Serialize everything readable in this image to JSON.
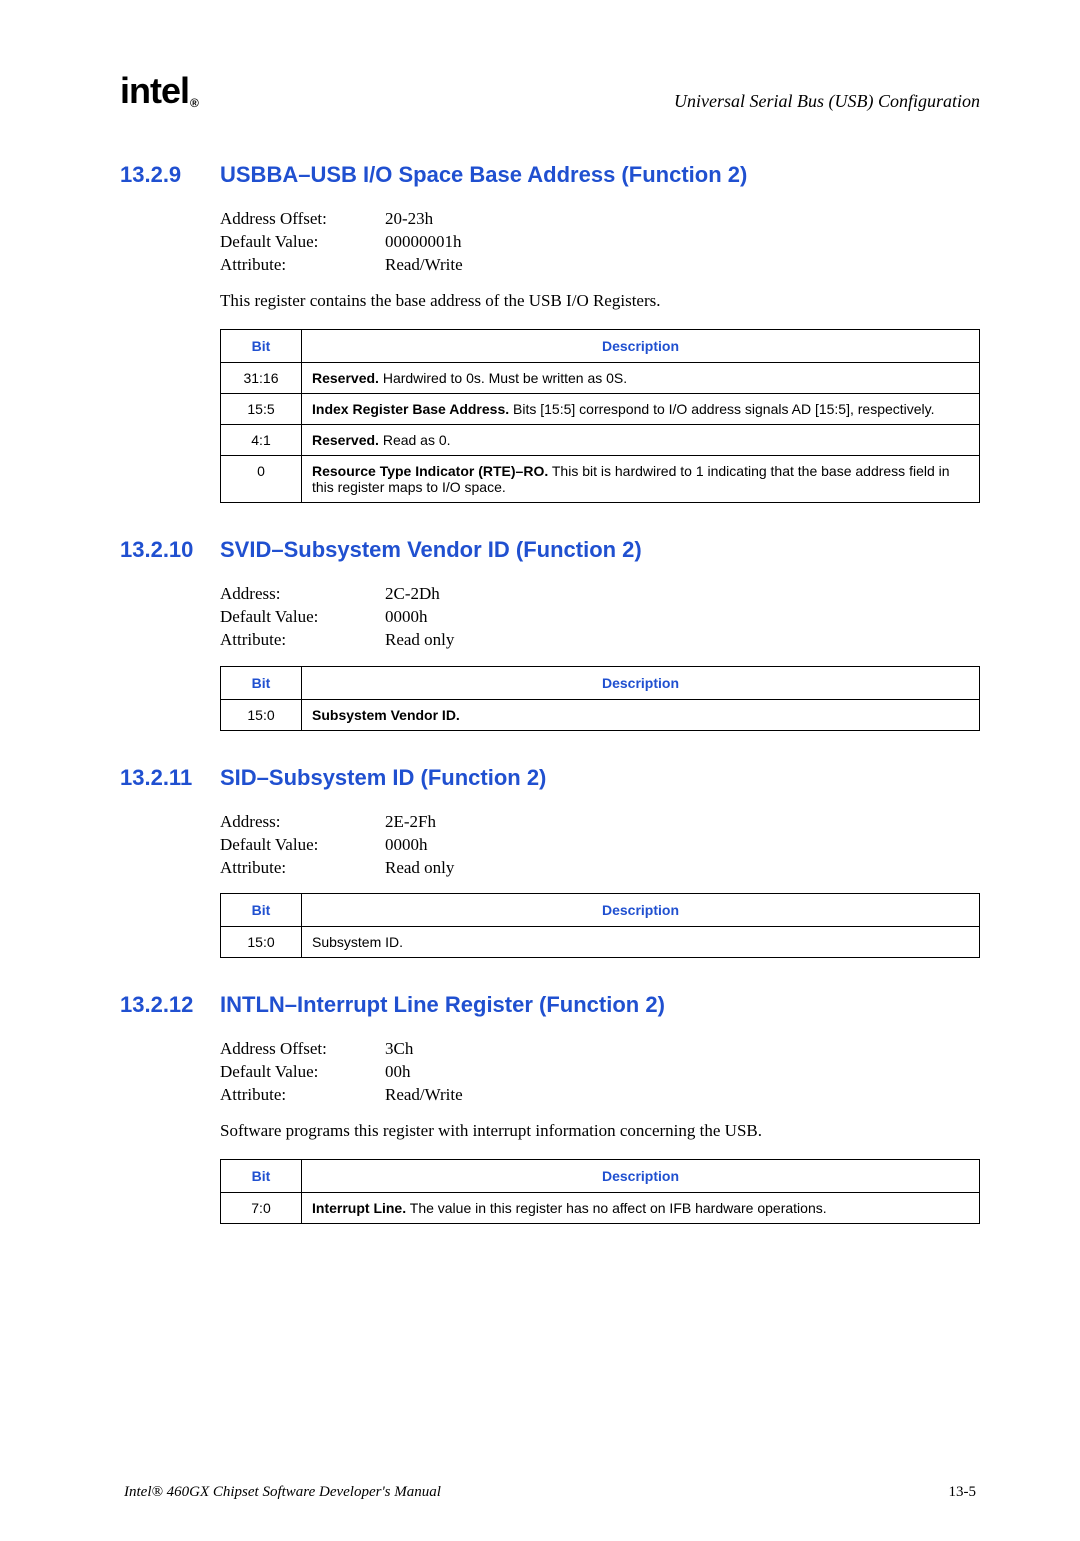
{
  "header": {
    "logo": "intel",
    "logo_sub": "®",
    "title": "Universal Serial Bus (USB) Configuration"
  },
  "sections": [
    {
      "num": "13.2.9",
      "title": "USBBA–USB I/O Space Base Address (Function 2)",
      "attrs": [
        {
          "label": "Address Offset:",
          "value": "20-23h"
        },
        {
          "label": "Default Value:",
          "value": "00000001h"
        },
        {
          "label": "Attribute:",
          "value": "Read/Write"
        }
      ],
      "desc": "This register contains the base address of the USB I/O Registers.",
      "table": {
        "headers": [
          "Bit",
          "Description"
        ],
        "rows": [
          {
            "bit": "31:16",
            "bold": "Reserved.",
            "rest": " Hardwired to 0s. Must be written as 0S."
          },
          {
            "bit": "15:5",
            "bold": "Index Register Base Address.",
            "rest": " Bits [15:5] correspond to I/O address signals AD [15:5], respectively."
          },
          {
            "bit": "4:1",
            "bold": "Reserved.",
            "rest": " Read as 0."
          },
          {
            "bit": "0",
            "bold": "Resource Type Indicator (RTE)–RO.",
            "rest": " This bit is hardwired to 1 indicating that the base address field in this register maps to I/O space."
          }
        ]
      }
    },
    {
      "num": "13.2.10",
      "title": "SVID–Subsystem Vendor ID (Function 2)",
      "attrs": [
        {
          "label": "Address:",
          "value": "2C-2Dh"
        },
        {
          "label": "Default Value:",
          "value": "0000h"
        },
        {
          "label": "Attribute:",
          "value": "Read only"
        }
      ],
      "desc": "",
      "table": {
        "headers": [
          "Bit",
          "Description"
        ],
        "rows": [
          {
            "bit": "15:0",
            "bold": "Subsystem Vendor ID.",
            "rest": ""
          }
        ]
      }
    },
    {
      "num": "13.2.11",
      "title": "SID–Subsystem ID (Function 2)",
      "attrs": [
        {
          "label": "Address:",
          "value": "2E-2Fh"
        },
        {
          "label": "Default Value:",
          "value": "0000h"
        },
        {
          "label": "Attribute:",
          "value": "Read only"
        }
      ],
      "desc": "",
      "table": {
        "headers": [
          "Bit",
          "Description"
        ],
        "rows": [
          {
            "bit": "15:0",
            "bold": "",
            "rest": "Subsystem ID."
          }
        ]
      }
    },
    {
      "num": "13.2.12",
      "title": "INTLN–Interrupt Line Register (Function 2)",
      "attrs": [
        {
          "label": "Address Offset:",
          "value": "3Ch"
        },
        {
          "label": "Default Value:",
          "value": "00h"
        },
        {
          "label": "Attribute:",
          "value": "Read/Write"
        }
      ],
      "desc": "Software programs this register with interrupt information concerning the USB.",
      "table": {
        "headers": [
          "Bit",
          "Description"
        ],
        "rows": [
          {
            "bit": "7:0",
            "bold": "Interrupt Line.",
            "rest": " The value in this register has no affect on IFB hardware operations."
          }
        ]
      }
    }
  ],
  "footer": {
    "left": "Intel® 460GX Chipset Software Developer's Manual",
    "right": "13-5"
  }
}
